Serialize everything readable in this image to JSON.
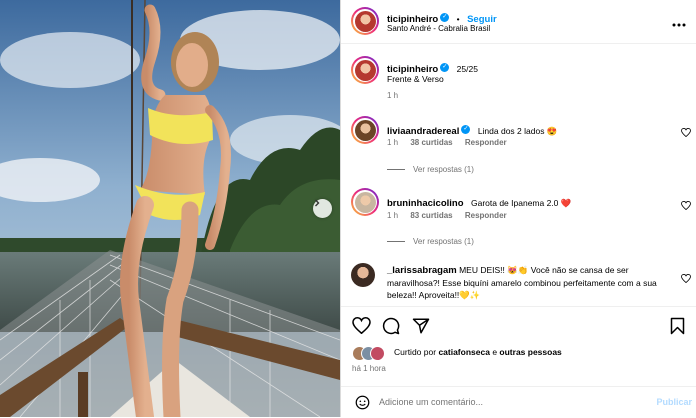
{
  "header": {
    "username": "ticipinheiro",
    "follow": "Seguir",
    "dot": "•",
    "location": "Santo André - Cabralia Brasil",
    "more_icon": "more-horizontal-icon"
  },
  "caption": {
    "username": "ticipinheiro",
    "text1": "25/25",
    "text2": "Frente & Verso",
    "time": "1 h"
  },
  "comments": [
    {
      "username": "liviaandradereal",
      "text": "Linda dos 2 lados 😍",
      "time": "1 h",
      "likes": "38 curtidas",
      "reply": "Responder",
      "view_replies": "Ver respostas (1)"
    },
    {
      "username": "bruninhacicolino",
      "text": "Garota de Ipanema 2.0 ❤️",
      "time": "1 h",
      "likes": "83 curtidas",
      "reply": "Responder",
      "view_replies": "Ver respostas (1)"
    },
    {
      "username": "_larissabragam",
      "text": "MEU DEIS!! 😻👏 Você não se cansa de ser maravilhosa?! Esse biquíni amarelo combinou perfeitamente com a sua beleza!! Aproveita!!💛✨"
    }
  ],
  "actions": {
    "liked_by_prefix": "Curtido por",
    "liked_by_user": "catiafonseca",
    "liked_by_and": "e",
    "liked_by_others": "outras pessoas",
    "time": "há 1 hora"
  },
  "comment_box": {
    "placeholder": "Adicione um comentário...",
    "publish": "Publicar"
  },
  "colors": {
    "accent": "#0095f6",
    "muted": "#737373",
    "bikini": "#f2e35a"
  }
}
